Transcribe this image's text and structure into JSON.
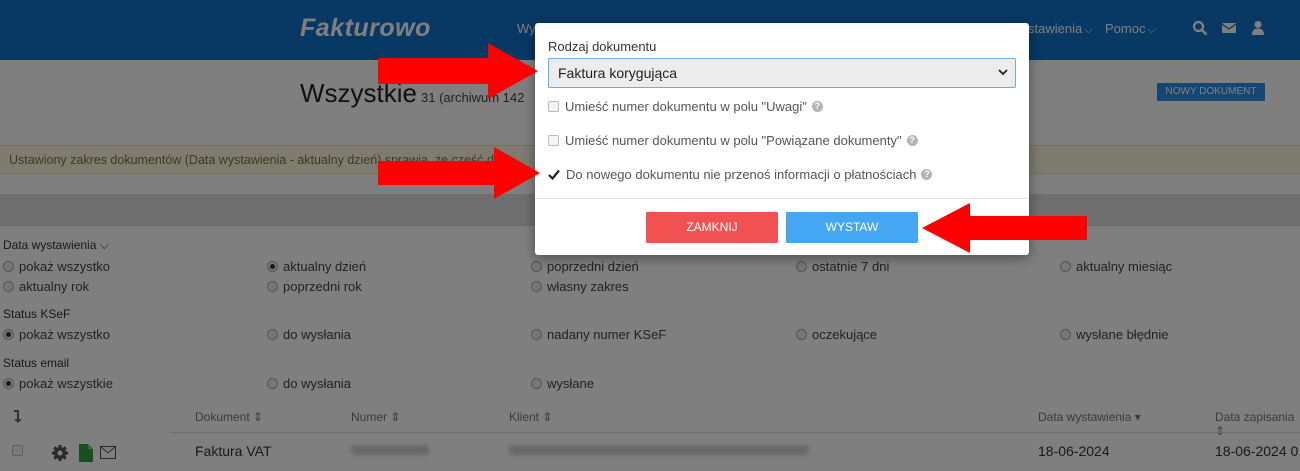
{
  "header": {
    "logo": "Fakturowo",
    "nav": [
      {
        "label": "Wy"
      },
      {
        "label": "stawienia"
      },
      {
        "label": "Pomoc"
      }
    ]
  },
  "page": {
    "title": "Wszystkie",
    "subtitle": "31 (archiwum 142",
    "new_document_button": "NOWY DOKUMENT",
    "alert": "Ustawiony zakres dokumentów (Data wystawienia - aktualny dzień) sprawia, że część do"
  },
  "filters": {
    "date": {
      "label": "Data wystawienia",
      "options": [
        {
          "label": "pokaż wszystko",
          "checked": false
        },
        {
          "label": "aktualny dzień",
          "checked": true
        },
        {
          "label": "poprzedni dzień",
          "checked": false
        },
        {
          "label": "ostatnie 7 dni",
          "checked": false
        },
        {
          "label": "aktualny miesiąc",
          "checked": false
        },
        {
          "label": "aktualny rok",
          "checked": false
        },
        {
          "label": "poprzedni rok",
          "checked": false
        },
        {
          "label": "własny zakres",
          "checked": false
        }
      ]
    },
    "ksef": {
      "label": "Status KSeF",
      "options": [
        {
          "label": "pokaż wszystko",
          "checked": true
        },
        {
          "label": "do wysłania",
          "checked": false
        },
        {
          "label": "nadany numer KSeF",
          "checked": false
        },
        {
          "label": "oczekujące",
          "checked": false
        },
        {
          "label": "wysłane błędnie",
          "checked": false
        }
      ]
    },
    "email": {
      "label": "Status email",
      "options": [
        {
          "label": "pokaż wszystkie",
          "checked": true
        },
        {
          "label": "do wysłania",
          "checked": false
        },
        {
          "label": "wysłane",
          "checked": false
        }
      ]
    }
  },
  "table": {
    "columns": [
      "Dokument ⇕",
      "Numer ⇕",
      "Klient ⇕",
      "Data wystawienia ▾",
      "Data zapisania ⇕"
    ],
    "rows": [
      {
        "document": "Faktura VAT",
        "issue_date": "18-06-2024",
        "save_date": "18-06-2024 0"
      }
    ]
  },
  "modal": {
    "label": "Rodzaj dokumentu",
    "select_value": "Faktura korygująca",
    "checkboxes": [
      {
        "label": "Umieść numer dokumentu w polu \"Uwagi\"",
        "checked": false
      },
      {
        "label": "Umieść numer dokumentu w polu \"Powiązane dokumenty\"",
        "checked": false
      },
      {
        "label": "Do nowego dokumentu nie przenoś informacji o płatnościach",
        "checked": true
      }
    ],
    "close_button": "ZAMKNIJ",
    "issue_button": "WYSTAW"
  },
  "colors": {
    "header": "#0f73c9",
    "close_button": "#f25151",
    "issue_button": "#45a7f3",
    "arrow": "#ff0000"
  }
}
